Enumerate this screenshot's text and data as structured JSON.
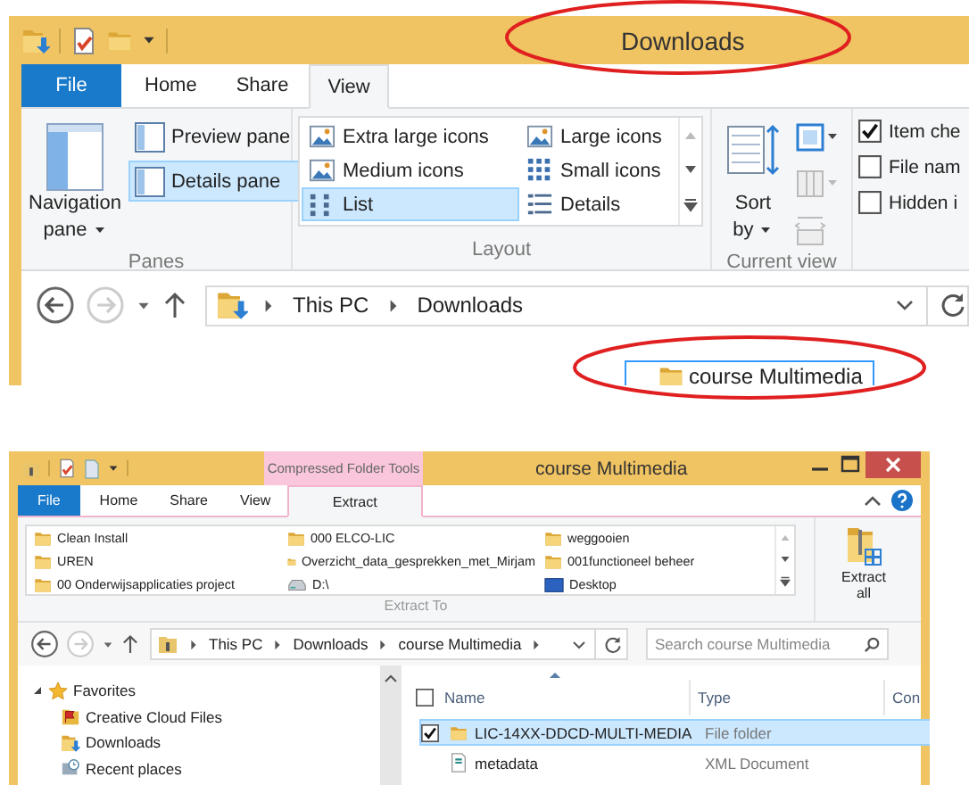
{
  "top_window": {
    "title": "Downloads",
    "tabs": [
      {
        "label": "File",
        "kind": "file",
        "selected": false
      },
      {
        "label": "Home",
        "kind": "tab",
        "selected": false
      },
      {
        "label": "Share",
        "kind": "tab",
        "selected": false
      },
      {
        "label": "View",
        "kind": "tab",
        "selected": true
      }
    ],
    "panes": {
      "label": "Panes",
      "navigation_pane": "Navigation pane",
      "items": [
        {
          "label": "Preview pane",
          "selected": false
        },
        {
          "label": "Details pane",
          "selected": true
        }
      ]
    },
    "layout": {
      "label": "Layout",
      "items": [
        {
          "label": "Extra large icons",
          "selected": false
        },
        {
          "label": "Large icons",
          "selected": false
        },
        {
          "label": "Medium icons",
          "selected": false
        },
        {
          "label": "Small icons",
          "selected": false
        },
        {
          "label": "List",
          "selected": true
        },
        {
          "label": "Details",
          "selected": false
        }
      ]
    },
    "current_view": {
      "label": "Current view",
      "sort_by": "Sort by"
    },
    "show_hide": [
      {
        "label": "Item che",
        "checked": true
      },
      {
        "label": "File nam",
        "checked": false
      },
      {
        "label": "Hidden i",
        "checked": false
      }
    ],
    "address": [
      "This PC",
      "Downloads"
    ],
    "rename_field": {
      "value": "course Multimedia"
    }
  },
  "bottom_window": {
    "contextual_group": "Compressed Folder Tools",
    "title": "course Multimedia",
    "tabs": [
      {
        "label": "File",
        "kind": "file",
        "selected": false
      },
      {
        "label": "Home",
        "kind": "tab",
        "selected": false
      },
      {
        "label": "Share",
        "kind": "tab",
        "selected": false
      },
      {
        "label": "View",
        "kind": "tab",
        "selected": false
      },
      {
        "label": "Extract",
        "kind": "contextual",
        "selected": true
      }
    ],
    "destinations": [
      {
        "label": "Clean Install",
        "kind": "folder"
      },
      {
        "label": "000 ELCO-LIC",
        "kind": "folder"
      },
      {
        "label": "weggooien",
        "kind": "folder"
      },
      {
        "label": "UREN",
        "kind": "folder"
      },
      {
        "label": "Overzicht_data_gesprekken_met_Mirjam",
        "kind": "folder"
      },
      {
        "label": "001functioneel beheer",
        "kind": "folder"
      },
      {
        "label": "00 Onderwijsapplicaties project",
        "kind": "folder"
      },
      {
        "label": "D:\\",
        "kind": "drive"
      },
      {
        "label": "Desktop",
        "kind": "desktop"
      }
    ],
    "extract_all": "Extract all",
    "group_label": "Extract To",
    "address": [
      "This PC",
      "Downloads",
      "course Multimedia"
    ],
    "search": {
      "placeholder": "Search course Multimedia"
    },
    "navigation": [
      {
        "label": "Favorites",
        "kind": "favorites",
        "expanded": true,
        "children": [
          {
            "label": "Creative Cloud Files",
            "kind": "cloud"
          },
          {
            "label": "Downloads",
            "kind": "downloads"
          },
          {
            "label": "Recent places",
            "kind": "recent"
          }
        ]
      }
    ],
    "columns": [
      "Name",
      "Type",
      "Con"
    ],
    "header_checkbox": {
      "checked": false
    },
    "rows": [
      {
        "name": "LIC-14XX-DDCD-MULTI-MEDIA",
        "type": "File folder",
        "kind": "folder",
        "selected": true
      },
      {
        "name": "metadata",
        "type": "XML Document",
        "kind": "xml",
        "selected": false
      }
    ]
  }
}
